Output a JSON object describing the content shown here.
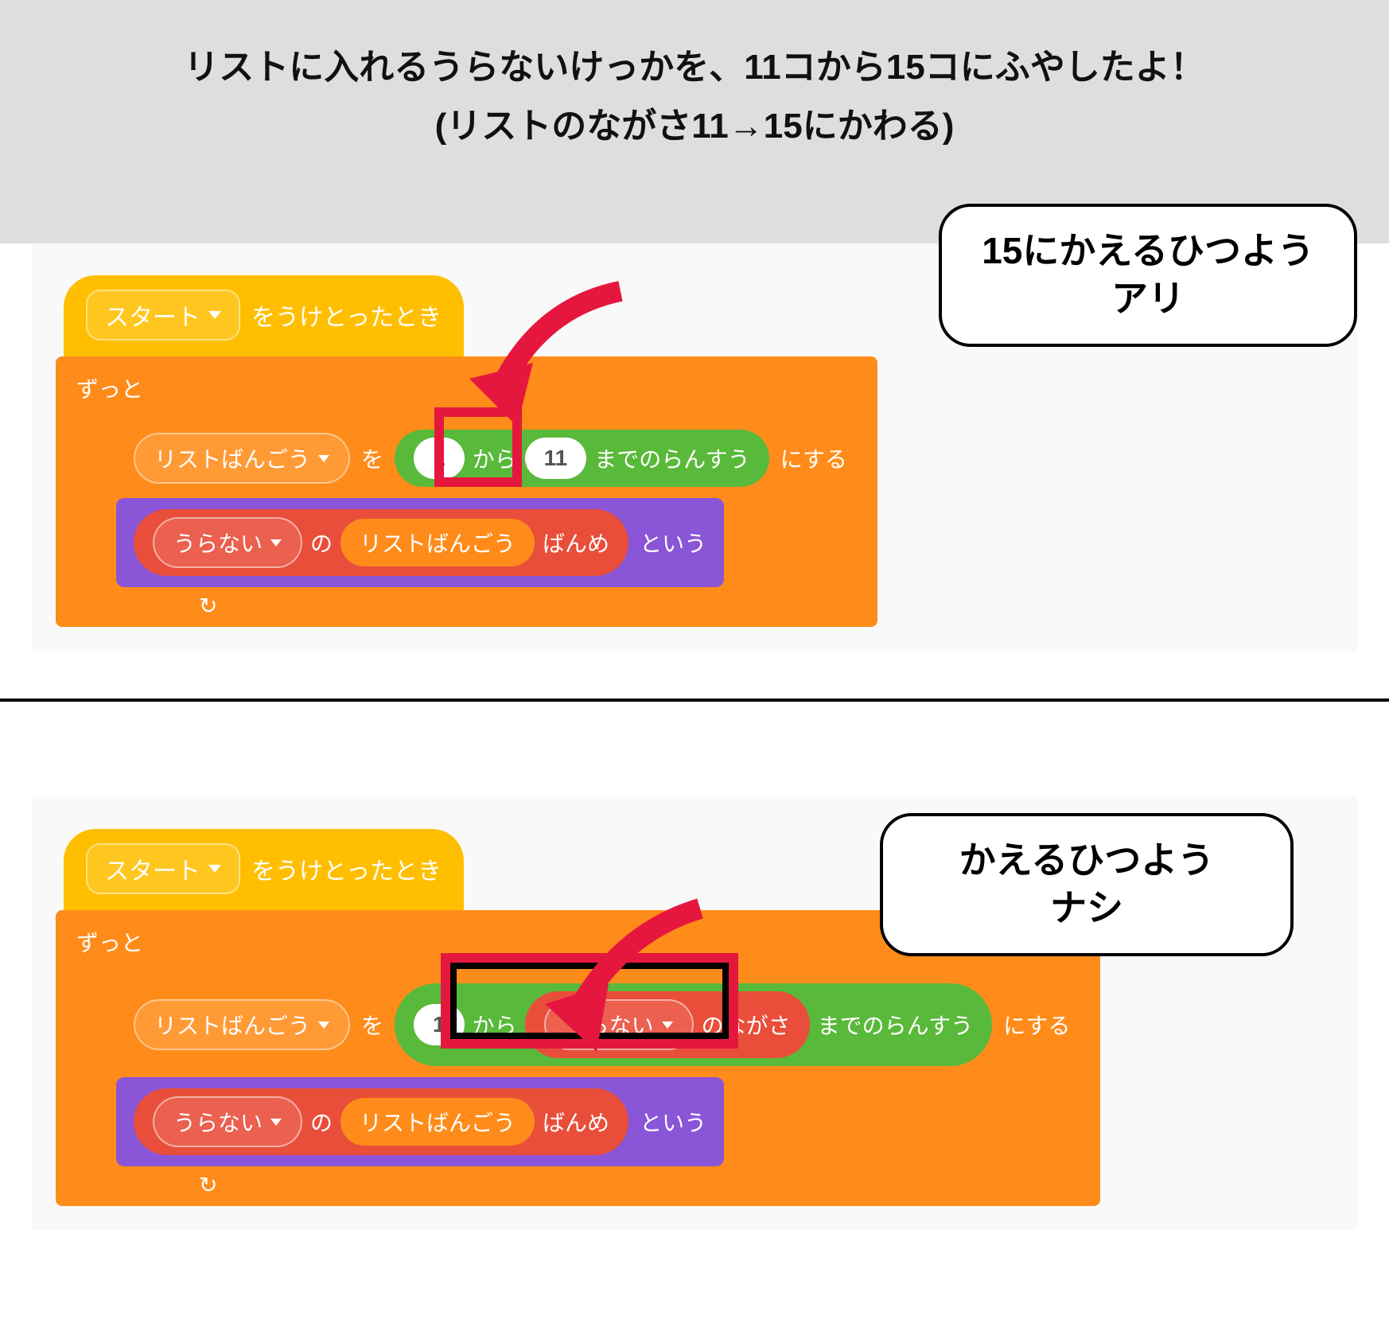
{
  "header": {
    "line1": "リストに入れるうらないけっかを、11コから15コにふやしたよ！",
    "line2": "(リストのながさ11→15にかわる)"
  },
  "callouts": {
    "top": {
      "line1": "15にかえるひつよう",
      "line2": "アリ"
    },
    "bottom": {
      "line1": "かえるひつよう",
      "line2": "ナシ"
    }
  },
  "blocks": {
    "hat": {
      "dropdown": "スタート",
      "suffix": "をうけとったとき"
    },
    "forever": "ずっと",
    "set_var": {
      "var_dropdown": "リストばんごう",
      "to": "を",
      "suffix": "にする"
    },
    "random": {
      "from_val": "1",
      "mid": "から",
      "to_val": "11",
      "suffix": "までのらんすう"
    },
    "length_of": {
      "list_dropdown": "うらない",
      "suffix": "のながさ"
    },
    "say": {
      "list_dropdown": "うらない",
      "of": "の",
      "index_var": "リストばんごう",
      "item": "ばんめ",
      "suffix": "という"
    }
  }
}
